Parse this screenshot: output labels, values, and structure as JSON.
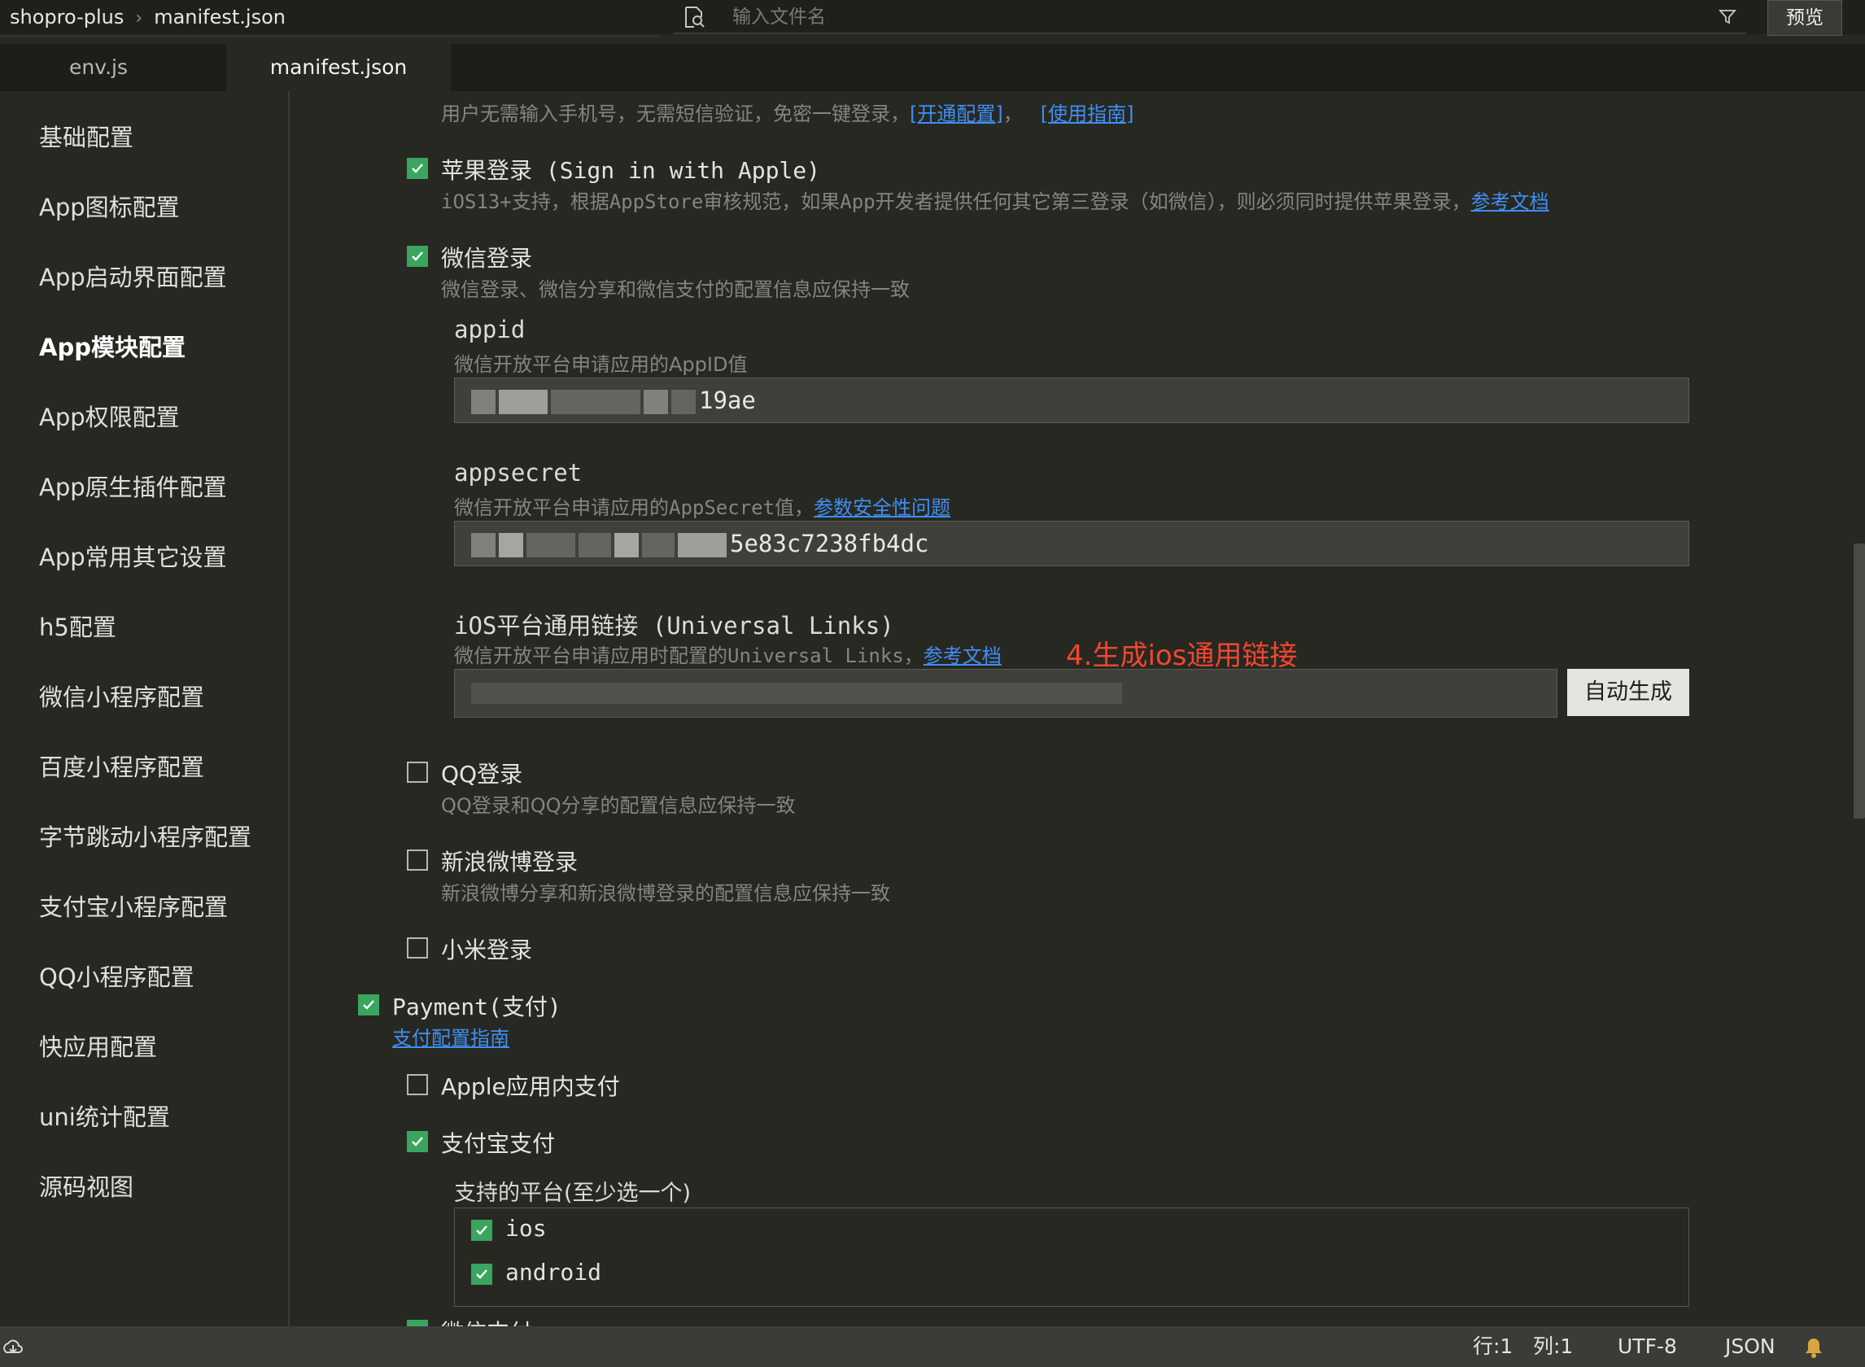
{
  "topbar": {
    "breadcrumb_project": "shopro-plus",
    "breadcrumb_file": "manifest.json",
    "search_placeholder": "输入文件名",
    "preview_label": "预览"
  },
  "tabs": [
    {
      "label": "env.js",
      "active": false
    },
    {
      "label": "manifest.json",
      "active": true
    }
  ],
  "sidebar": {
    "items": [
      {
        "label": "基础配置"
      },
      {
        "label": "App图标配置"
      },
      {
        "label": "App启动界面配置"
      },
      {
        "label": "App模块配置",
        "active": true
      },
      {
        "label": "App权限配置"
      },
      {
        "label": "App原生插件配置"
      },
      {
        "label": "App常用其它设置"
      },
      {
        "label": "h5配置"
      },
      {
        "label": "微信小程序配置"
      },
      {
        "label": "百度小程序配置"
      },
      {
        "label": "字节跳动小程序配置"
      },
      {
        "label": "支付宝小程序配置"
      },
      {
        "label": "QQ小程序配置"
      },
      {
        "label": "快应用配置"
      },
      {
        "label": "uni统计配置"
      },
      {
        "label": "源码视图"
      }
    ]
  },
  "main": {
    "oneclick_desc": "用户无需输入手机号，无需短信验证，免密一键登录，",
    "oneclick_link1": "[开通配置]",
    "oneclick_sep": "，",
    "oneclick_link2": "[使用指南]",
    "apple_login": {
      "label": "苹果登录 (Sign in with Apple)",
      "checked": true,
      "desc": "iOS13+支持，根据AppStore审核规范，如果App开发者提供任何其它第三登录（如微信），则必须同时提供苹果登录，",
      "link": "参考文档"
    },
    "wechat_login": {
      "label": "微信登录",
      "checked": true,
      "desc": "微信登录、微信分享和微信支付的配置信息应保持一致"
    },
    "appid": {
      "label": "appid",
      "desc": "微信开放平台申请应用的AppID值",
      "value_visible": "19ae"
    },
    "appsecret": {
      "label": "appsecret",
      "desc": "微信开放平台申请应用的AppSecret值，",
      "link": "参数安全性问题",
      "value_visible": "5e83c7238fb4dc"
    },
    "universal_links": {
      "label": "iOS平台通用链接 (Universal Links)",
      "desc": "微信开放平台申请应用时配置的Universal Links，",
      "link": "参考文档",
      "annotation": "4.生成ios通用链接",
      "button": "自动生成"
    },
    "qq_login": {
      "label": "QQ登录",
      "checked": false,
      "desc": "QQ登录和QQ分享的配置信息应保持一致"
    },
    "weibo_login": {
      "label": "新浪微博登录",
      "checked": false,
      "desc": "新浪微博分享和新浪微博登录的配置信息应保持一致"
    },
    "xiaomi_login": {
      "label": "小米登录",
      "checked": false
    },
    "payment": {
      "label": "Payment(支付)",
      "checked": true,
      "link": "支付配置指南"
    },
    "apple_iap": {
      "label": "Apple应用内支付",
      "checked": false
    },
    "alipay": {
      "label": "支付宝支付",
      "checked": true
    },
    "platforms": {
      "label": "支持的平台(至少选一个)",
      "items": [
        {
          "label": "ios",
          "checked": true
        },
        {
          "label": "android",
          "checked": true
        }
      ]
    },
    "partial_next": "微信支付"
  },
  "statusbar": {
    "line": "行:1",
    "col": "列:1",
    "encoding": "UTF-8",
    "language": "JSON"
  },
  "colors": {
    "background": "#272822",
    "accent_check": "#3aa55e",
    "link": "#3f8ef2",
    "annotation": "#f2462d"
  }
}
